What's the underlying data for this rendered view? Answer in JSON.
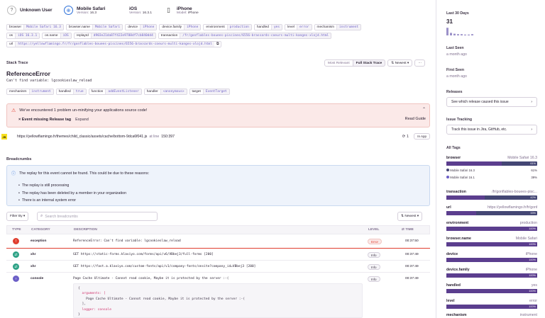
{
  "context": [
    {
      "title": "Unknown User",
      "sub": []
    },
    {
      "title": "Mobile Safari",
      "sub": [
        {
          "k": "Version:",
          "v": "16.3"
        }
      ]
    },
    {
      "title": "iOS",
      "sub": [
        {
          "k": "Version:",
          "v": "16.3.1"
        }
      ]
    },
    {
      "title": "iPhone",
      "sub": [
        {
          "k": "Model:",
          "v": "iPhone"
        }
      ]
    }
  ],
  "tags_row1": [
    {
      "k": "browser",
      "v": "Mobile Safari 16.3"
    },
    {
      "k": "browser.name",
      "v": "Mobile Safari"
    },
    {
      "k": "device",
      "v": "iPhone"
    },
    {
      "k": "device.family",
      "v": "iPhone"
    },
    {
      "k": "environment",
      "v": "production"
    },
    {
      "k": "handled",
      "v": "yes"
    },
    {
      "k": "level",
      "v": "error"
    },
    {
      "k": "mechanism",
      "v": "instrument"
    }
  ],
  "tags_row2": [
    {
      "k": "os",
      "v": "iOS 16.3.1"
    },
    {
      "k": "os.name",
      "v": "iOS"
    },
    {
      "k": "replayId",
      "v": "d903e21da87f422e9788df7cb840dd4"
    },
    {
      "k": "transaction",
      "v": "/fr/gonflables-bouees-piscines/6556-brassards-coeurs-multi-kanges-xlojd.html"
    }
  ],
  "tags_row3": [
    {
      "k": "url",
      "v": "https://yellowflamingo.fr/fr/gonflables-bouees-piscines/6556-brassards-coeurs-multi-kanges-xlojd.html"
    }
  ],
  "stack": {
    "heading": "Stack Trace",
    "btn_relevant": "Most Relevant",
    "btn_full": "Full Stack Trace",
    "btn_sort": "Newest",
    "btn_more": "···",
    "error_type": "ReferenceError",
    "error_msg": "Can't find variable: lgcookieslaw_reload",
    "mech_tags": [
      {
        "k": "mechanism",
        "v": "instrument"
      },
      {
        "k": "handled",
        "v": "true"
      },
      {
        "k": "function",
        "v": "addEventListener"
      },
      {
        "k": "handler",
        "v": "<anonymous>"
      },
      {
        "k": "target",
        "v": "EventTarget"
      }
    ],
    "warn_text": "We've encountered 1 problem un-minifying your applications source code!",
    "warn_sub": "Event missing Release tag",
    "warn_expand": "Expand",
    "warn_guide": "Read Guide",
    "frame_badge": "JS",
    "frame_url": "https://yellowflamingo.fr/themes/child_classic/assets/cache/bottom-9dca6f041.js",
    "frame_at": "at line",
    "frame_line": "150:397",
    "frame_count": "1",
    "frame_inapp": "In App"
  },
  "breadcrumbs": {
    "heading": "Breadcrumbs",
    "info": "The replay for this event cannot be found. This could be due to these reasons:",
    "reasons": [
      "The replay is still processing",
      "The replay has been deleted by a member in your organization",
      "There is an internal system error"
    ],
    "filter": "Filter By",
    "search_placeholder": "Search breadcrumbs",
    "sort": "Newest",
    "cols": {
      "type": "TYPE",
      "category": "CATEGORY",
      "description": "DESCRIPTION",
      "level": "LEVEL",
      "time": "TIME"
    },
    "rows": [
      {
        "category": "exception",
        "desc": "ReferenceError: Can't find variable: lgcookieslaw_reload",
        "level": "Error",
        "time": "00:37:50",
        "color": "#e03e2f",
        "glyph": "!"
      },
      {
        "category": "xhr",
        "desc": "GET https://static-forms.klaviyo.com/forms/api/v6/VBbej3/full-forms [200]",
        "level": "Info",
        "time": "00:37:49",
        "color": "#2ba185",
        "glyph": "⇄"
      },
      {
        "category": "xhr",
        "desc": "GET https://fast.a.klaviyo.com/custom-fonts/api/v1/company-fonts/onsite?company_id=VBbej3 [200]",
        "level": "Info",
        "time": "00:37:49",
        "color": "#2ba185",
        "glyph": "⇄"
      },
      {
        "category": "console",
        "desc": "Page Cache Ultimate - Cannot read cookie, Maybe it is protected by the server :-(",
        "level": "Info",
        "time": "00:37:49",
        "color": "#6c5fc7",
        "glyph": "›"
      }
    ],
    "code": [
      "{",
      "  arguments: [",
      "    Page Cache Ultimate - Cannot read cookie, Maybe it is protected by the server :-(",
      "  ],",
      "  logger: console",
      "}"
    ]
  },
  "sidebar": {
    "last30": "Last 30 Days",
    "count": "31",
    "spark": [
      0.9,
      0.3,
      0.2,
      0.15,
      0.15,
      0.1,
      0.1,
      0.15
    ],
    "last_seen": "Last Seen",
    "last_seen_v": "a month ago",
    "first_seen": "First Seen",
    "first_seen_v": "a month ago",
    "releases": "Releases",
    "releases_btn": "See which release caused this issue",
    "tracking": "Issue Tracking",
    "tracking_btn": "Track this issue in Jira, GitHub, etc.",
    "all_tags": "All Tags",
    "tags": [
      {
        "n": "browser",
        "v": "Mobile Safari 16.3",
        "pct": 61,
        "p": "61%"
      },
      {
        "n": "transaction",
        "v": "/fr/gonflables-bouees-pisc...",
        "pct": 42,
        "p": "42%"
      },
      {
        "n": "url",
        "v": "https://yellowflamingo.fr/fr/gonflabl...",
        "pct": 33,
        "p": "33%"
      },
      {
        "n": "environment",
        "v": "production",
        "pct": 100,
        "p": "100%"
      },
      {
        "n": "browser.name",
        "v": "Mobile Safari",
        "pct": 100,
        "p": "100%"
      },
      {
        "n": "device",
        "v": "iPhone",
        "pct": 100,
        "p": "100%"
      },
      {
        "n": "device.family",
        "v": "iPhone",
        "pct": 100,
        "p": "100%"
      },
      {
        "n": "handled",
        "v": "yes",
        "pct": 100,
        "p": "100%"
      },
      {
        "n": "level",
        "v": "error",
        "pct": 100,
        "p": "100%"
      },
      {
        "n": "mechanism",
        "v": "instrument",
        "pct": 100,
        "p": "100%"
      }
    ],
    "browser_sub": [
      {
        "n": "Mobile Safari 16.3",
        "p": "61%",
        "color": "#444674"
      },
      {
        "n": "Mobile Safari 16.1",
        "p": "39%",
        "color": "#6c5fc7"
      }
    ]
  }
}
